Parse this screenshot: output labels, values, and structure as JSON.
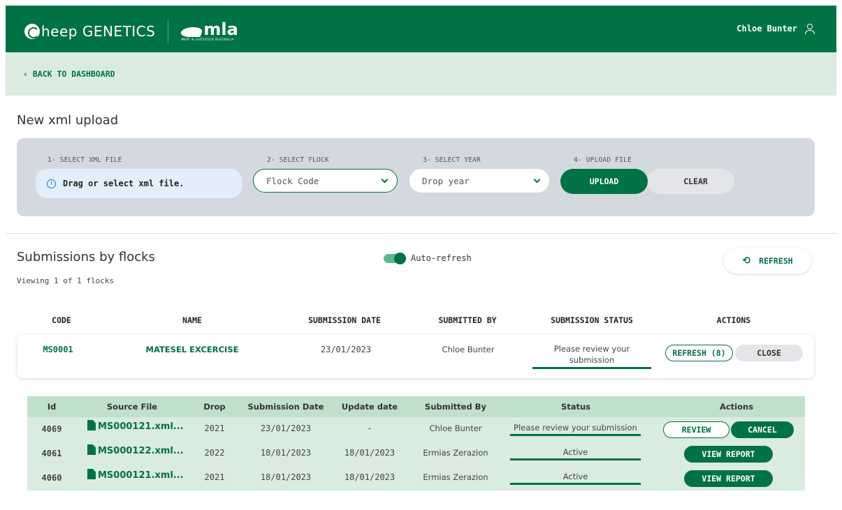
{
  "header": {
    "brand_name": "heep GENETICS",
    "partner_logo": "mla",
    "partner_sub": "MEAT & LIVESTOCK AUSTRALIA",
    "user_name": "Chloe Bunter",
    "user_icon": "user-icon"
  },
  "nav": {
    "back_label": "‹  BACK TO DASHBOARD"
  },
  "upload": {
    "title": "New xml upload",
    "step1_label": "1- SELECT XML FILE",
    "step2_label": "2- SELECT FLOCK",
    "step3_label": "3- SELECT YEAR",
    "step4_label": "4- UPLOAD FILE",
    "dropzone_text": "Drag or select xml file.",
    "flock_placeholder": "Flock Code",
    "year_placeholder": "Drop year",
    "upload_label": "UPLOAD",
    "clear_label": "CLEAR"
  },
  "submissions": {
    "title": "Submissions by flocks",
    "viewing": "Viewing 1 of 1 flocks",
    "auto_refresh_label": "Auto-refresh",
    "auto_refresh_on": true,
    "refresh_label": "REFRESH",
    "columns": {
      "code": "CODE",
      "name": "NAME",
      "date": "SUBMISSION DATE",
      "by": "SUBMITTED BY",
      "status": "SUBMISSION STATUS",
      "actions": "ACTIONS"
    },
    "flock": {
      "code": "MS0001",
      "name": "MATESEL EXCERCISE",
      "date": "23/01/2023",
      "by": "Chloe Bunter",
      "status": "Please review your submission",
      "refresh_btn": "REFRESH (8)",
      "close_btn": "CLOSE"
    }
  },
  "details": {
    "columns": {
      "id": "Id",
      "source": "Source File",
      "drop": "Drop",
      "sub_date": "Submission Date",
      "upd_date": "Update date",
      "by": "Submitted By",
      "status": "Status",
      "actions": "Actions"
    },
    "rows": [
      {
        "id": "4069",
        "file": "MS000121.xml...",
        "drop": "2021",
        "sub_date": "23/01/2023",
        "upd_date": "-",
        "by": "Chloe Bunter",
        "status": "Please review your submission",
        "action1": "REVIEW",
        "action2": "CANCEL"
      },
      {
        "id": "4061",
        "file": "MS000122.xml...",
        "drop": "2022",
        "sub_date": "18/01/2023",
        "upd_date": "18/01/2023",
        "by": "Ermias Zerazion",
        "status": "Active",
        "action1": "VIEW REPORT"
      },
      {
        "id": "4060",
        "file": "MS000121.xml...",
        "drop": "2021",
        "sub_date": "18/01/2023",
        "upd_date": "18/01/2023",
        "by": "Ermias Zerazion",
        "status": "Active",
        "action1": "VIEW REPORT"
      }
    ]
  },
  "colors": {
    "brand_green": "#007244",
    "light_green": "#d9ecdf",
    "panel_grey": "#d4d9e0"
  }
}
